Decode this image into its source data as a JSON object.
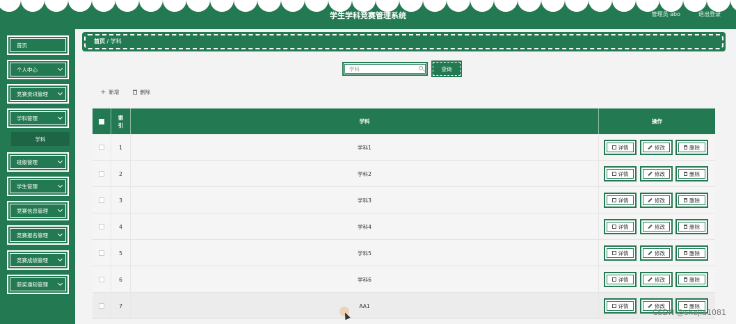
{
  "header": {
    "title": "学生学科竞赛管理系统",
    "user": "管理员 abo",
    "logout": "退出登录"
  },
  "sidebar": {
    "items": [
      {
        "label": "首页"
      },
      {
        "label": "个人中心"
      },
      {
        "label": "竞赛资讯管理"
      },
      {
        "label": "学科管理"
      },
      {
        "label": "班级管理"
      },
      {
        "label": "学生管理"
      },
      {
        "label": "竞赛信息管理"
      },
      {
        "label": "竞赛报名管理"
      },
      {
        "label": "竞赛成绩管理"
      },
      {
        "label": "获奖通知管理"
      }
    ],
    "sub": {
      "label": "学科"
    }
  },
  "breadcrumb": {
    "home": "首页",
    "sep": "/",
    "current": "学科"
  },
  "search": {
    "placeholder": "学科",
    "button": "查询"
  },
  "actions": {
    "add": "新增",
    "delete": "删除"
  },
  "table": {
    "headers": {
      "index": "索引",
      "subject": "学科",
      "ops": "操作"
    },
    "rows": [
      {
        "index": "1",
        "subject": "学科1"
      },
      {
        "index": "2",
        "subject": "学科2"
      },
      {
        "index": "3",
        "subject": "学科3"
      },
      {
        "index": "4",
        "subject": "学科4"
      },
      {
        "index": "5",
        "subject": "学科5"
      },
      {
        "index": "6",
        "subject": "学科6"
      },
      {
        "index": "7",
        "subject": "AA1"
      }
    ],
    "ops": {
      "detail": "详情",
      "edit": "修改",
      "delete": "删除"
    }
  },
  "watermark": "CSDN @shejia1081",
  "colors": {
    "primary": "#237a52",
    "background": "#f3f3f3"
  }
}
